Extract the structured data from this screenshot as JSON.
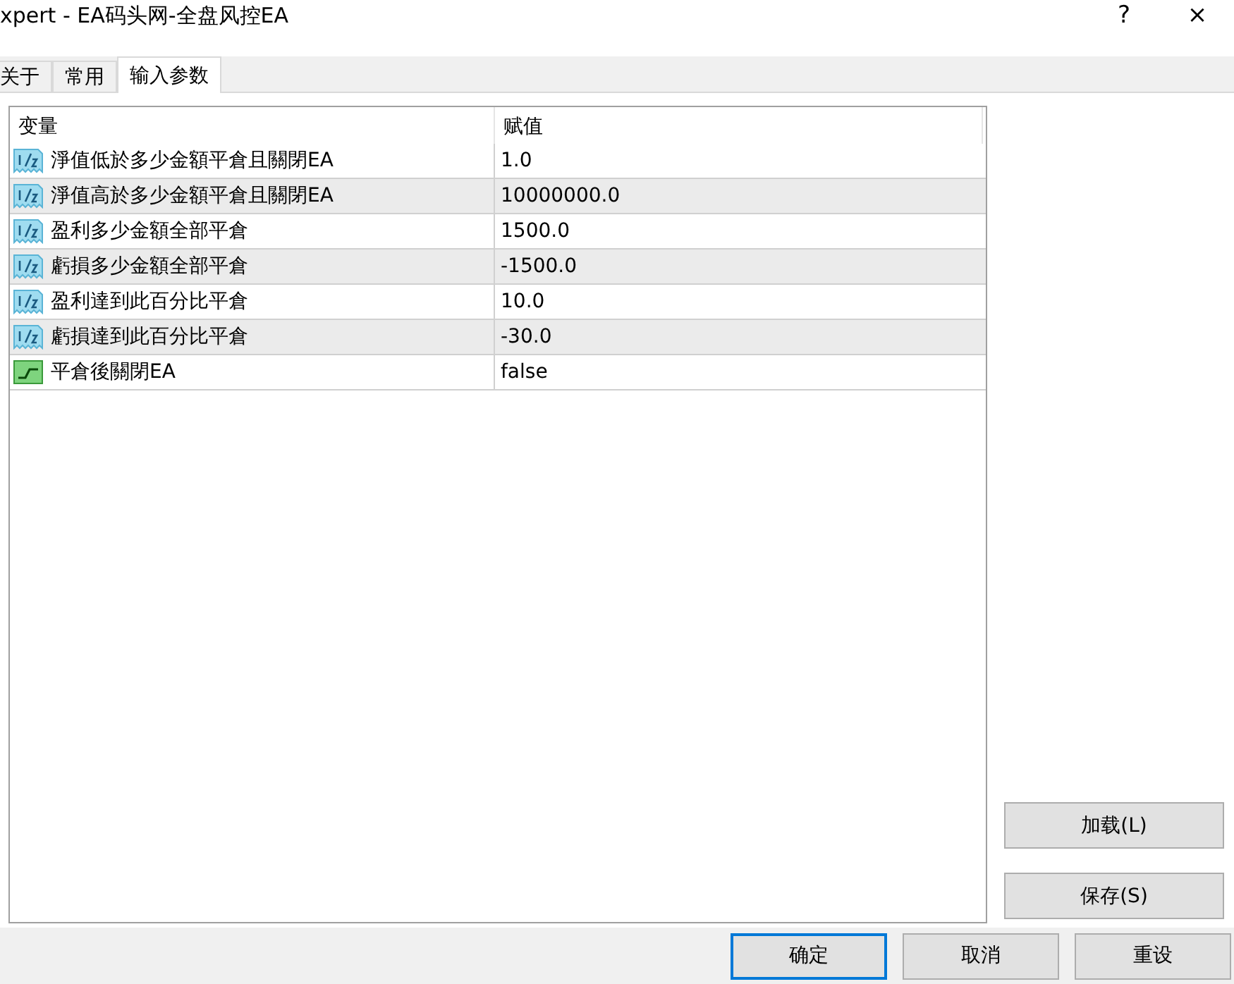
{
  "window": {
    "title": "xpert - EA码头网-全盘风控EA",
    "help": "?",
    "close": "×"
  },
  "tabs": [
    {
      "label": "关于",
      "selected": false
    },
    {
      "label": "常用",
      "selected": false
    },
    {
      "label": "输入参数",
      "selected": true
    }
  ],
  "table": {
    "columns": [
      "变量",
      "赋值"
    ],
    "rows": [
      {
        "kind": "double",
        "name": "淨值低於多少金額平倉且關閉EA",
        "value": "1.0"
      },
      {
        "kind": "double",
        "name": "淨值高於多少金額平倉且關閉EA",
        "value": "10000000.0"
      },
      {
        "kind": "double",
        "name": "盈利多少金額全部平倉",
        "value": "1500.0"
      },
      {
        "kind": "double",
        "name": "虧損多少金額全部平倉",
        "value": "-1500.0"
      },
      {
        "kind": "double",
        "name": "盈利達到此百分比平倉",
        "value": "10.0"
      },
      {
        "kind": "double",
        "name": "虧損達到此百分比平倉",
        "value": "-30.0"
      },
      {
        "kind": "bool",
        "name": "平倉後關閉EA",
        "value": "false"
      }
    ]
  },
  "side_buttons": [
    "加载(L)",
    "保存(S)"
  ],
  "buttons": [
    {
      "label": "确定",
      "default": true
    },
    {
      "label": "取消",
      "default": false
    },
    {
      "label": "重设",
      "default": false
    }
  ]
}
